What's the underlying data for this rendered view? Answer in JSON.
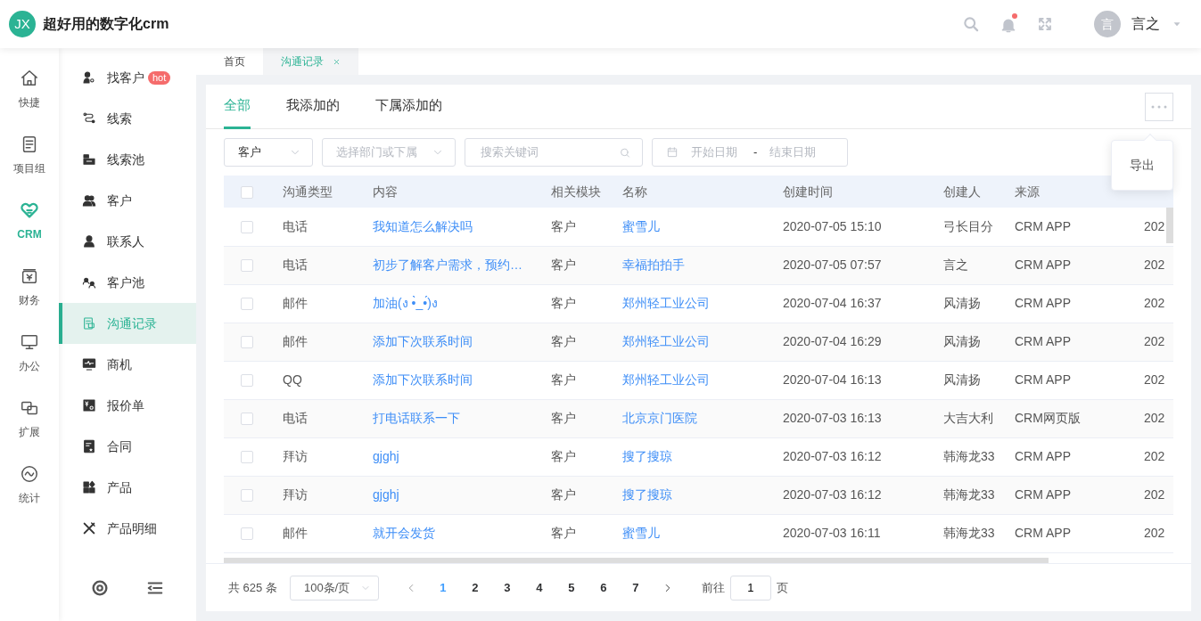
{
  "header": {
    "logo": "JX",
    "title": "超好用的数字化crm",
    "has_unread": true,
    "user": {
      "avatar_text": "言",
      "name": "言之"
    }
  },
  "rail": [
    {
      "label": "快捷",
      "selected": false
    },
    {
      "label": "项目组",
      "selected": false
    },
    {
      "label": "CRM",
      "selected": true
    },
    {
      "label": "财务",
      "selected": false
    },
    {
      "label": "办公",
      "selected": false
    },
    {
      "label": "扩展",
      "selected": false
    },
    {
      "label": "统计",
      "selected": false
    }
  ],
  "submenu": [
    {
      "label": "找客户",
      "badge": "hot",
      "selected": false
    },
    {
      "label": "线索",
      "selected": false
    },
    {
      "label": "线索池",
      "selected": false
    },
    {
      "label": "客户",
      "selected": false
    },
    {
      "label": "联系人",
      "selected": false
    },
    {
      "label": "客户池",
      "selected": false
    },
    {
      "label": "沟通记录",
      "selected": true
    },
    {
      "label": "商机",
      "selected": false
    },
    {
      "label": "报价单",
      "selected": false
    },
    {
      "label": "合同",
      "selected": false
    },
    {
      "label": "产品",
      "selected": false
    },
    {
      "label": "产品明细",
      "selected": false
    }
  ],
  "page_tabs": [
    {
      "label": "首页",
      "selected": false,
      "closable": false
    },
    {
      "label": "沟通记录",
      "selected": true,
      "closable": true
    }
  ],
  "tabs": [
    {
      "label": "全部",
      "selected": true
    },
    {
      "label": "我添加的",
      "selected": false
    },
    {
      "label": "下属添加的",
      "selected": false
    }
  ],
  "filters": {
    "type_value": "客户",
    "dept_placeholder": "选择部门或下属",
    "search_placeholder": "搜索关键词",
    "start_placeholder": "开始日期",
    "separator": "-",
    "end_placeholder": "结束日期"
  },
  "more_menu": {
    "items": [
      "导出"
    ]
  },
  "table": {
    "columns": [
      {
        "label": "沟通类型",
        "kind": "text"
      },
      {
        "label": "内容",
        "kind": "link"
      },
      {
        "label": "相关模块",
        "kind": "text"
      },
      {
        "label": "名称",
        "kind": "link"
      },
      {
        "label": "创建时间",
        "kind": "text"
      },
      {
        "label": "创建人",
        "kind": "text"
      },
      {
        "label": "来源",
        "kind": "text"
      },
      {
        "kind": "text"
      }
    ],
    "all_checked": false,
    "rows": [
      {
        "checked": false,
        "cells": [
          "电话",
          "我知道怎么解决吗",
          "客户",
          "蜜雪儿",
          "2020-07-05 15:10",
          "弓长目分",
          "CRM APP",
          "202"
        ]
      },
      {
        "checked": false,
        "cells": [
          "电话",
          "初步了解客户需求，预约…",
          "客户",
          "幸福拍拍手",
          "2020-07-05 07:57",
          "言之",
          "CRM APP",
          "202"
        ]
      },
      {
        "checked": false,
        "cells": [
          "邮件",
          "加油(ง •̀_•́)ง",
          "客户",
          "郑州轻工业公司",
          "2020-07-04 16:37",
          "风清扬",
          "CRM APP",
          "202"
        ]
      },
      {
        "checked": false,
        "cells": [
          "邮件",
          "添加下次联系时间",
          "客户",
          "郑州轻工业公司",
          "2020-07-04 16:29",
          "风清扬",
          "CRM APP",
          "202"
        ]
      },
      {
        "checked": false,
        "cells": [
          "QQ",
          "添加下次联系时间",
          "客户",
          "郑州轻工业公司",
          "2020-07-04 16:13",
          "风清扬",
          "CRM APP",
          "202"
        ]
      },
      {
        "checked": false,
        "cells": [
          "电话",
          "打电话联系一下",
          "客户",
          "北京京门医院",
          "2020-07-03 16:13",
          "大吉大利",
          "CRM网页版",
          "202"
        ]
      },
      {
        "checked": false,
        "cells": [
          "拜访",
          "gjghj",
          "客户",
          "搜了搜琼",
          "2020-07-03 16:12",
          "韩海龙33",
          "CRM APP",
          "202"
        ]
      },
      {
        "checked": false,
        "cells": [
          "拜访",
          "gjghj",
          "客户",
          "搜了搜琼",
          "2020-07-03 16:12",
          "韩海龙33",
          "CRM APP",
          "202"
        ]
      },
      {
        "checked": false,
        "cells": [
          "邮件",
          "就开会发货",
          "客户",
          "蜜雪儿",
          "2020-07-03 16:11",
          "韩海龙33",
          "CRM APP",
          "202"
        ]
      }
    ]
  },
  "pagination": {
    "total": "共 625 条",
    "page_size": "100条/页",
    "pages": [
      {
        "label": "1",
        "selected": true
      },
      {
        "label": "2",
        "selected": false
      },
      {
        "label": "3",
        "selected": false
      },
      {
        "label": "4",
        "selected": false
      },
      {
        "label": "5",
        "selected": false
      },
      {
        "label": "6",
        "selected": false
      },
      {
        "label": "7",
        "selected": false
      }
    ],
    "goto_label": "前往",
    "goto_value": "1",
    "goto_suffix": "页"
  }
}
